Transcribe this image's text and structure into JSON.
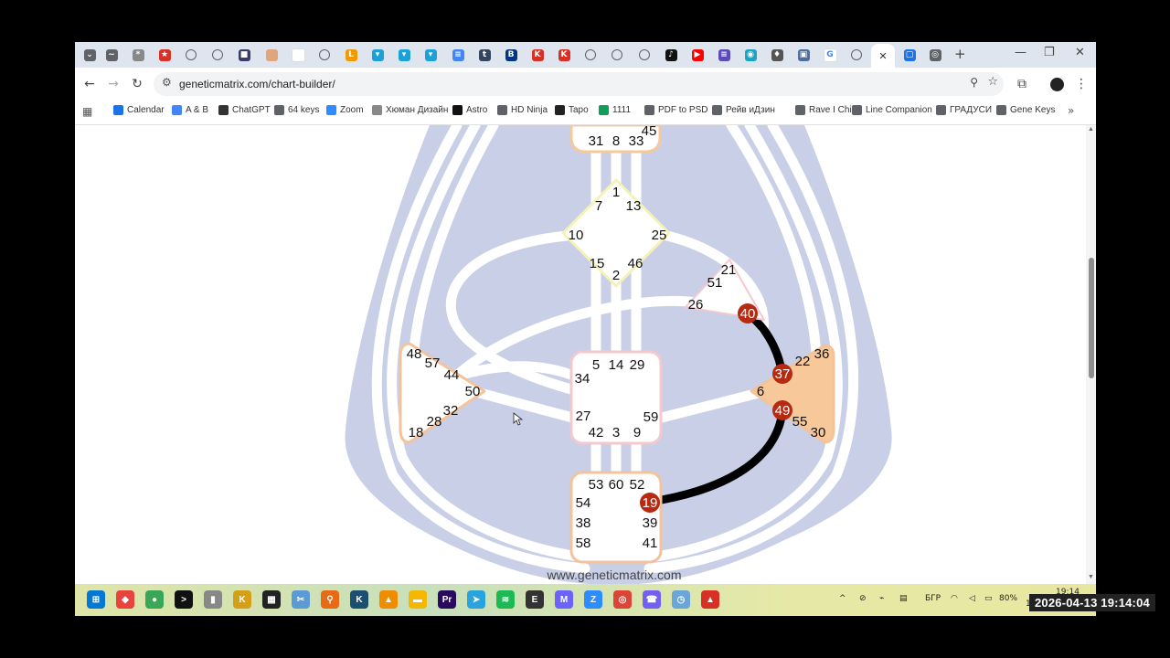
{
  "browser": {
    "url": "geneticmatrix.com/chart-builder/",
    "tabs": [
      {
        "name": "tab-dropdown-icon",
        "color": "#5f6368",
        "glyph": "⌄"
      },
      {
        "name": "activity-tab-icon",
        "color": "#5f6368",
        "glyph": "~"
      },
      {
        "name": "tab-icon",
        "color": "#888",
        "glyph": "*"
      },
      {
        "name": "star-tab-icon",
        "color": "#d93025",
        "glyph": "★"
      },
      {
        "name": "globe-icon",
        "color": "globe",
        "glyph": ""
      },
      {
        "name": "globe-icon",
        "color": "globe",
        "glyph": ""
      },
      {
        "name": "app-tab-icon",
        "color": "#3b3b6e",
        "glyph": "■"
      },
      {
        "name": "tab-icon",
        "color": "#e0a57a",
        "glyph": ""
      },
      {
        "name": "tab-icon",
        "color": "#ffffff",
        "glyph": ""
      },
      {
        "name": "globe-icon",
        "color": "globe",
        "glyph": ""
      },
      {
        "name": "app-tab-icon",
        "color": "#f29900",
        "glyph": "L"
      },
      {
        "name": "gene-keys-tab-icon",
        "color": "#1ba0d8",
        "glyph": "▾"
      },
      {
        "name": "gene-keys-tab-icon",
        "color": "#1ba0d8",
        "glyph": "▾"
      },
      {
        "name": "gene-keys-tab-icon",
        "color": "#1ba0d8",
        "glyph": "▾"
      },
      {
        "name": "docs-tab-icon",
        "color": "#4285f4",
        "glyph": "≡"
      },
      {
        "name": "tumblr-tab-icon",
        "color": "#35465c",
        "glyph": "t"
      },
      {
        "name": "booking-tab-icon",
        "color": "#003580",
        "glyph": "B"
      },
      {
        "name": "app-tab-icon",
        "color": "#d93025",
        "glyph": "K"
      },
      {
        "name": "app-tab-icon",
        "color": "#d93025",
        "glyph": "K"
      },
      {
        "name": "globe-icon",
        "color": "globe",
        "glyph": ""
      },
      {
        "name": "globe-icon",
        "color": "globe",
        "glyph": ""
      },
      {
        "name": "globe-icon",
        "color": "globe",
        "glyph": ""
      },
      {
        "name": "tiktok-tab-icon",
        "color": "#111",
        "glyph": "♪"
      },
      {
        "name": "youtube-tab-icon",
        "color": "#ff0000",
        "glyph": "▶"
      },
      {
        "name": "app-tab-icon",
        "color": "#5c4ab8",
        "glyph": "≡"
      },
      {
        "name": "app-tab-icon",
        "color": "#16a5c4",
        "glyph": "◉"
      },
      {
        "name": "app-tab-icon",
        "color": "#555",
        "glyph": "♦"
      },
      {
        "name": "app-tab-icon",
        "color": "#4a6fa5",
        "glyph": "▣"
      },
      {
        "name": "google-tab-icon",
        "color": "#ffffff",
        "glyph": "G"
      },
      {
        "name": "globe-icon",
        "color": "globe",
        "glyph": ""
      },
      {
        "name": "close-tab-icon",
        "color": "active",
        "glyph": "✕"
      },
      {
        "name": "app-tab-icon",
        "color": "#1a73e8",
        "glyph": "▢"
      },
      {
        "name": "chrome-tab-icon",
        "color": "#5f6368",
        "glyph": "◎"
      }
    ],
    "new_tab_glyph": "+",
    "window_controls": {
      "minimize": "—",
      "restore": "❐",
      "close": "✕"
    }
  },
  "bookmarks": [
    {
      "label": "Calendar",
      "color": "#1a73e8"
    },
    {
      "label": "A & B",
      "color": "#4285f4"
    },
    {
      "label": "ChatGPT",
      "color": "#333333"
    },
    {
      "label": "64 keys",
      "color": "#5f6368"
    },
    {
      "label": "Zoom",
      "color": "#2d8cff"
    },
    {
      "label": "Хюман Дизайн",
      "color": "#888888"
    },
    {
      "label": "Astro",
      "color": "#111111"
    },
    {
      "label": "HD Ninja",
      "color": "#5f6368"
    },
    {
      "label": "Tapo",
      "color": "#222222"
    },
    {
      "label": "1111",
      "color": "#0f9d58"
    },
    {
      "label": "PDF to PSD",
      "color": "#5f6368"
    },
    {
      "label": "Рейв иДзин",
      "color": "#5f6368"
    },
    {
      "label": "Rave I Ching",
      "color": "#5f6368"
    },
    {
      "label": "Line Companion",
      "color": "#5f6368"
    },
    {
      "label": "ГРАДУСИ",
      "color": "#5f6368"
    },
    {
      "label": "Gene Keys",
      "color": "#5f6368"
    }
  ],
  "bodygraph": {
    "watermark": "www.geneticmatrix.com",
    "colors": {
      "body": "#c8cfe6",
      "channel": "#ffffff",
      "active_channel": "#000000",
      "activated_gate": "#b52a10"
    },
    "centers": {
      "ajna": {
        "gates": [
          "31",
          "8",
          "33",
          "45"
        ],
        "color": "#f6c89a"
      },
      "g": {
        "gates": [
          "1",
          "7",
          "13",
          "10",
          "25",
          "15",
          "46",
          "2"
        ],
        "color": "#f5f2b8"
      },
      "ego": {
        "gates": [
          "21",
          "51",
          "26",
          "40"
        ],
        "color": "#f5c8ce"
      },
      "spleen": {
        "gates": [
          "48",
          "57",
          "44",
          "50",
          "32",
          "28",
          "18"
        ],
        "color": "#f4c39b"
      },
      "sacral": {
        "gates": [
          "5",
          "14",
          "29",
          "34",
          "27",
          "59",
          "42",
          "3",
          "9"
        ],
        "color": "#f5c8ce"
      },
      "solar_plexus": {
        "gates": [
          "36",
          "22",
          "37",
          "6",
          "49",
          "55",
          "30"
        ],
        "color": "#f4c39b",
        "fill": "#f6c89a"
      },
      "root": {
        "gates": [
          "53",
          "60",
          "52",
          "54",
          "19",
          "38",
          "39",
          "58",
          "41"
        ],
        "color": "#f4c39b"
      }
    }
  },
  "taskbar": {
    "apps": [
      {
        "name": "windows-start-icon",
        "color": "#0078d4",
        "glyph": "⊞"
      },
      {
        "name": "anydesk-icon",
        "color": "#e8433c",
        "glyph": "◆"
      },
      {
        "name": "browser-icon",
        "color": "#3aa757",
        "glyph": "●"
      },
      {
        "name": "terminal-icon",
        "color": "#111",
        "glyph": ">"
      },
      {
        "name": "usb-icon",
        "color": "#888",
        "glyph": "▮"
      },
      {
        "name": "app-icon",
        "color": "#d4a017",
        "glyph": "K"
      },
      {
        "name": "calculator-icon",
        "color": "#222",
        "glyph": "▦"
      },
      {
        "name": "snip-icon",
        "color": "#5b9bd5",
        "glyph": "✂"
      },
      {
        "name": "search-app-icon",
        "color": "#e86a17",
        "glyph": "⚲"
      },
      {
        "name": "photo-app-icon",
        "color": "#1b4f72",
        "glyph": "K"
      },
      {
        "name": "vlc-icon",
        "color": "#f08c00",
        "glyph": "▲"
      },
      {
        "name": "folder-icon",
        "color": "#f5b700",
        "glyph": "▬"
      },
      {
        "name": "premiere-icon",
        "color": "#2a0a5e",
        "glyph": "Pr"
      },
      {
        "name": "telegram-icon",
        "color": "#2aa3df",
        "glyph": "➤"
      },
      {
        "name": "spotify-icon",
        "color": "#1db954",
        "glyph": "≋"
      },
      {
        "name": "app-icon",
        "color": "#333",
        "glyph": "E"
      },
      {
        "name": "app-icon",
        "color": "#6c63ff",
        "glyph": "M"
      },
      {
        "name": "zoom-icon",
        "color": "#2d8cff",
        "glyph": "Z"
      },
      {
        "name": "chrome-icon",
        "color": "#db4437",
        "glyph": "◎"
      },
      {
        "name": "viber-icon",
        "color": "#7360f2",
        "glyph": "☎"
      },
      {
        "name": "clock-icon",
        "color": "#6aa7d8",
        "glyph": "◷"
      },
      {
        "name": "pdf-icon",
        "color": "#d93025",
        "glyph": "▲"
      }
    ],
    "tray": {
      "language": "БГР",
      "battery": "80%",
      "time": "19:14",
      "date": "13.04.2026"
    }
  },
  "recording_timestamp": "2026-04-13 19:14:04"
}
